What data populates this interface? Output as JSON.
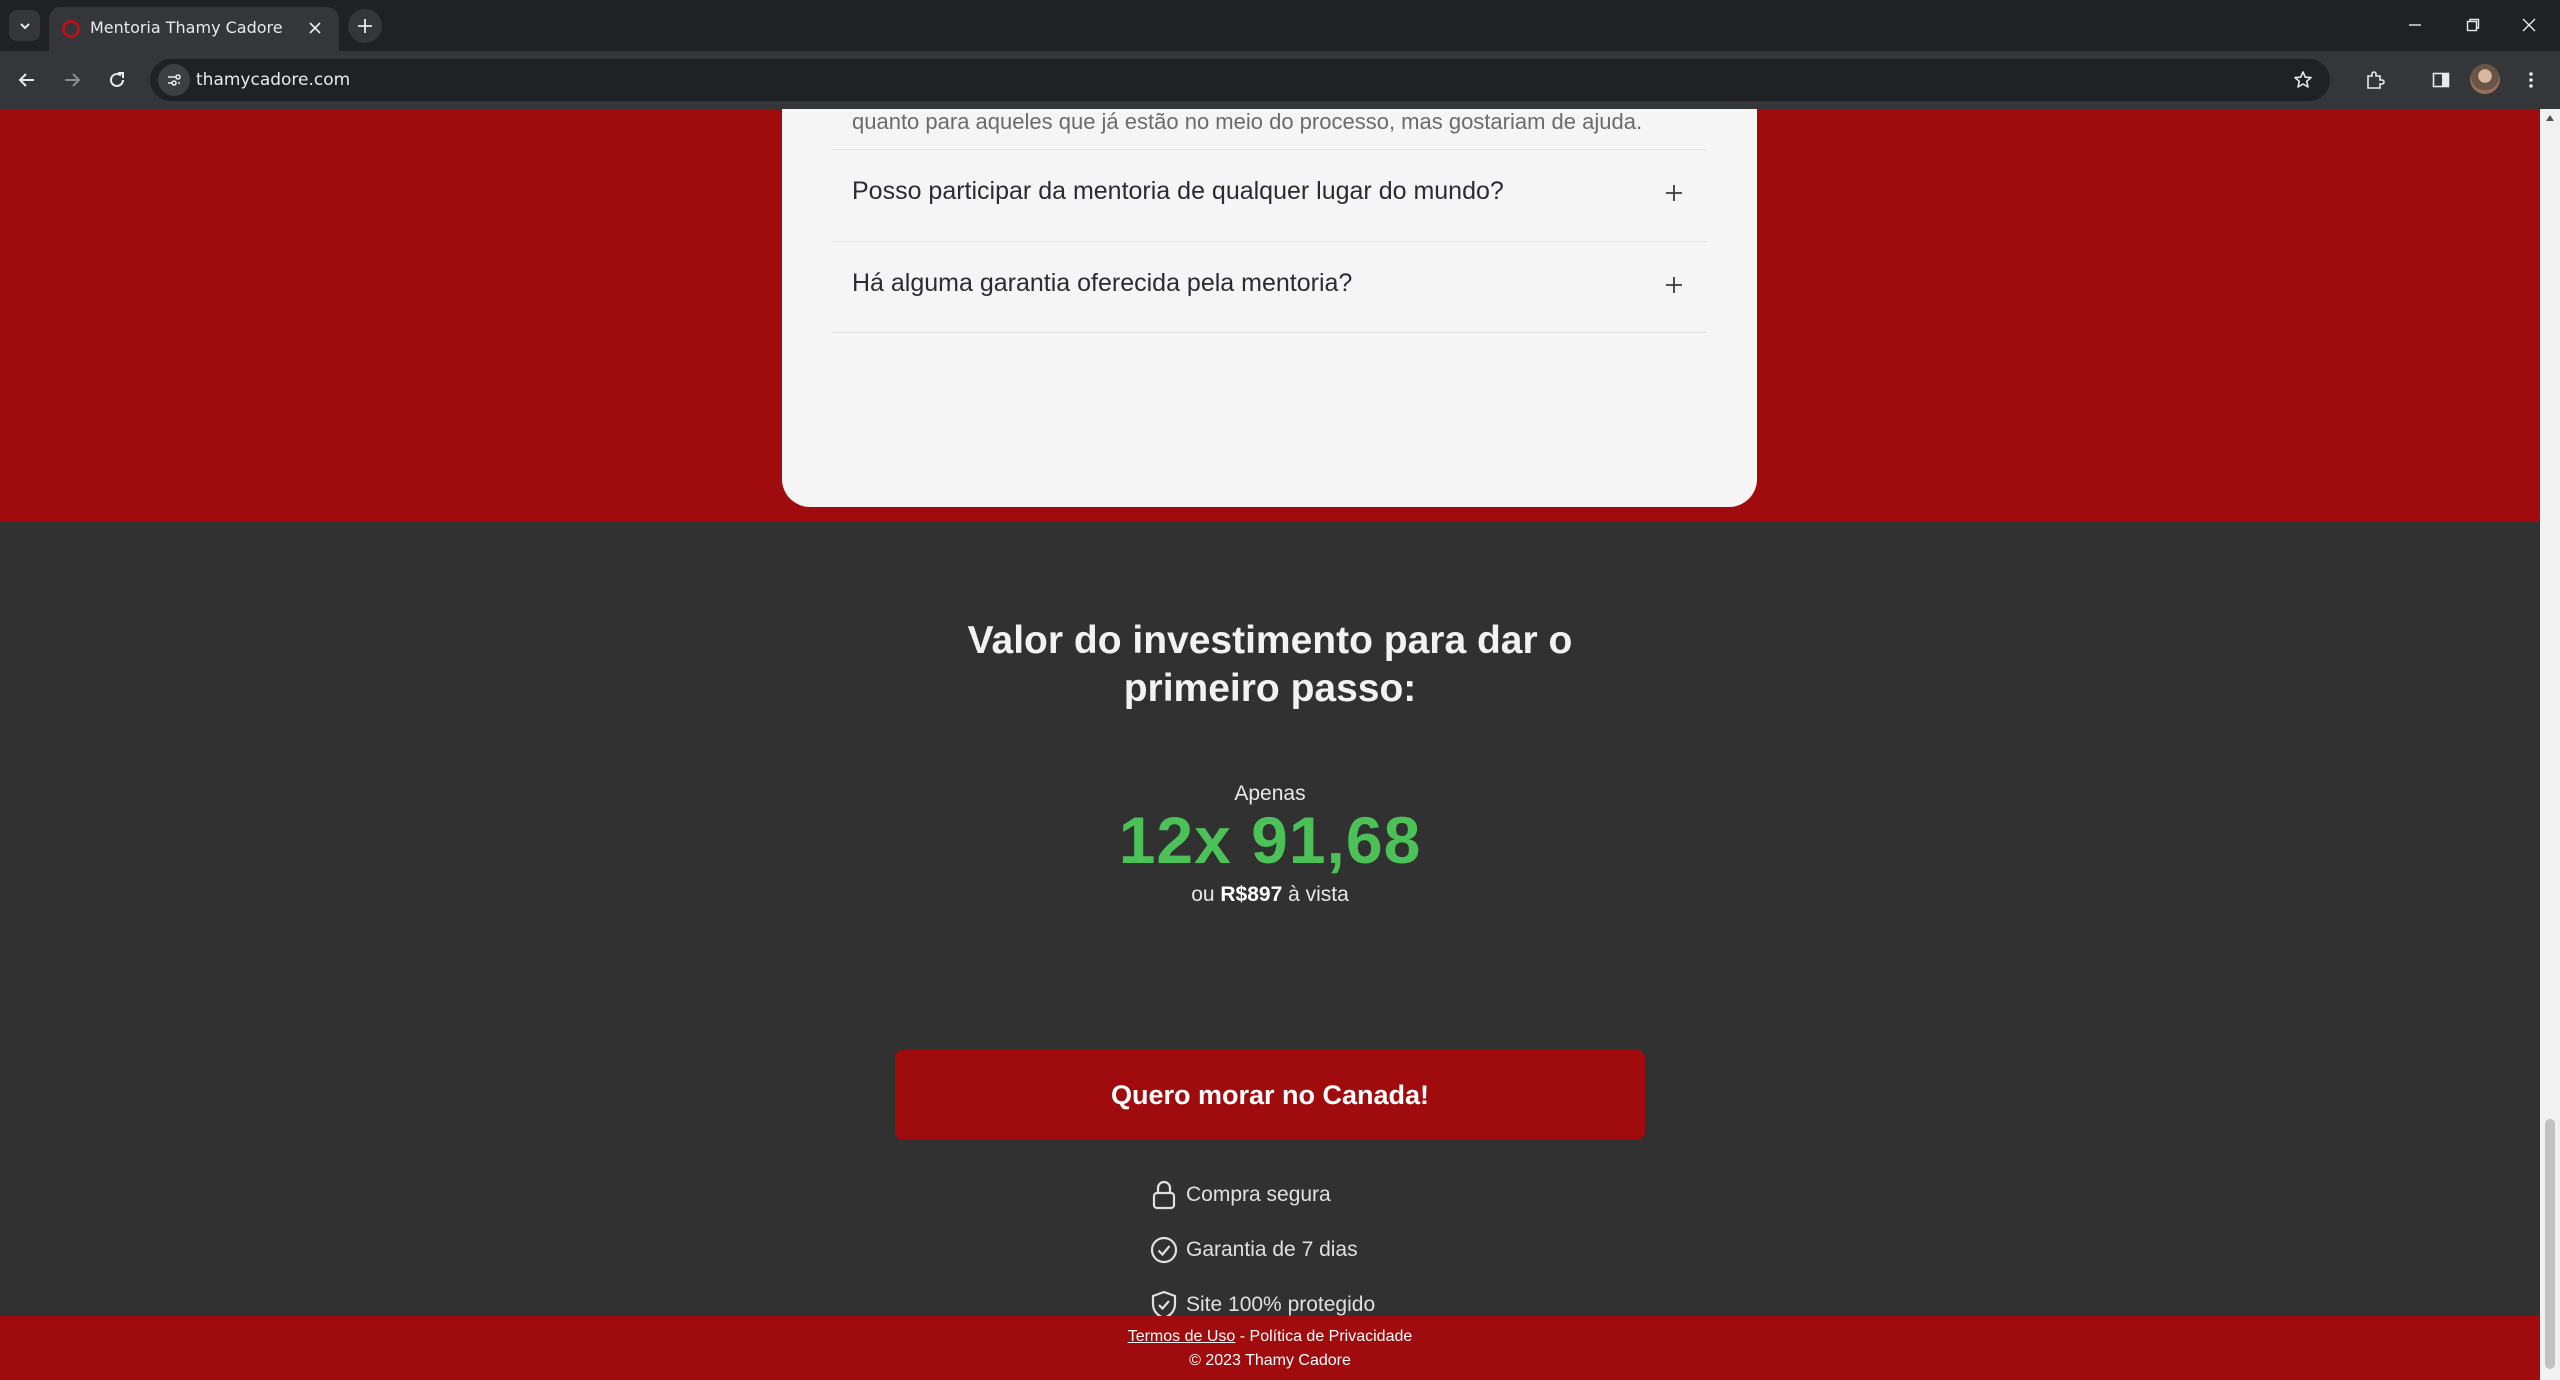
{
  "browser": {
    "tab_title": "Mentoria Thamy Cadore",
    "url": "thamycadore.com"
  },
  "faq": {
    "previous_answer_tail": "quanto para aqueles que já estão no meio do processo, mas gostariam de ajuda.",
    "items": [
      {
        "question": "Posso participar da mentoria de qualquer lugar do mundo?"
      },
      {
        "question": "Há alguma garantia oferecida pela mentoria?"
      }
    ]
  },
  "investment": {
    "title_line1": "Valor do investimento para dar o",
    "title_line2": "primeiro passo:",
    "apenas": "Apenas",
    "installments": "12x 91,68",
    "cash_prefix": "ou ",
    "cash_value": "R$897",
    "cash_suffix": " à vista",
    "cta_label": "Quero morar no Canada!",
    "badges": [
      {
        "icon": "lock-icon",
        "label": "Compra segura"
      },
      {
        "icon": "check-circle-icon",
        "label": "Garantia de 7 dias"
      },
      {
        "icon": "shield-check-icon",
        "label": "Site 100% protegido"
      }
    ]
  },
  "footer": {
    "terms": "Termos de Uso",
    "separator": " - ",
    "privacy": "Política de Privacidade",
    "copyright": "© 2023 Thamy Cadore"
  },
  "colors": {
    "brand_red": "#a00c0e",
    "price_green": "#4cc158",
    "dark_bg": "#313131"
  }
}
